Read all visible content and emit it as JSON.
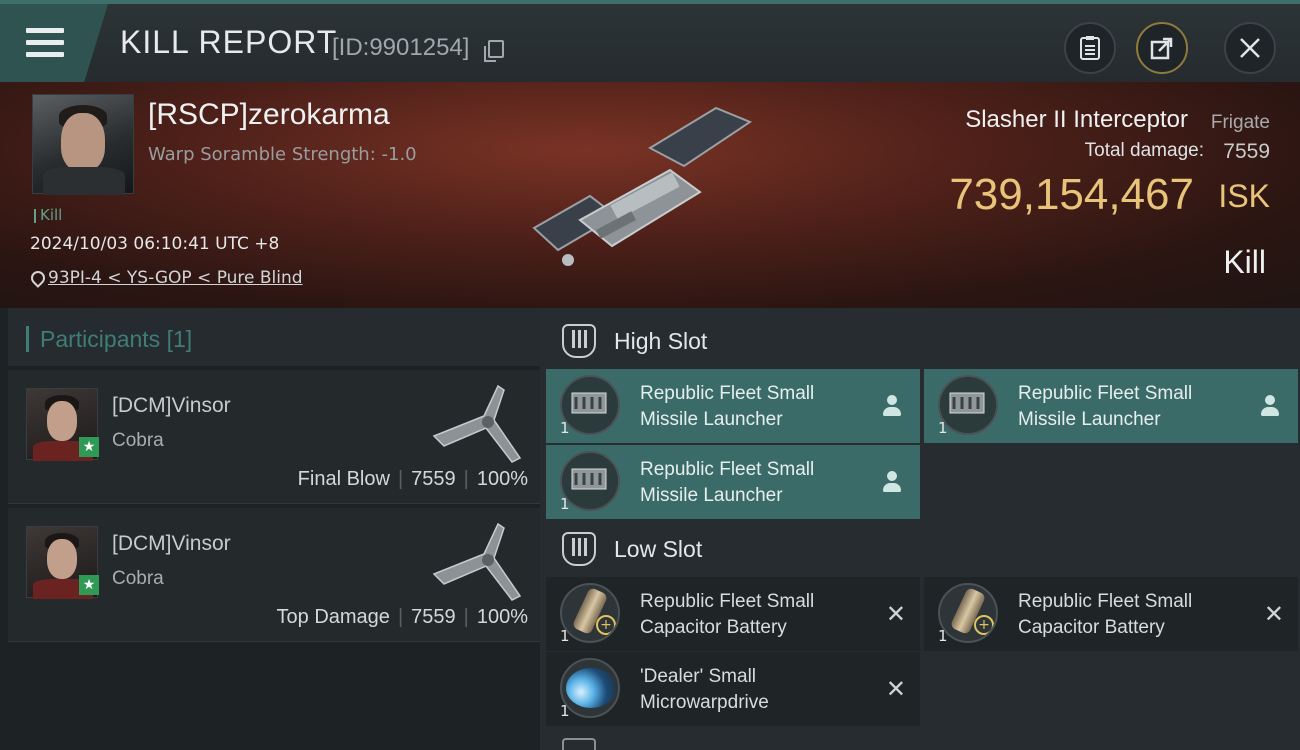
{
  "header": {
    "title": "KILL REPORT",
    "report_id": "[ID:9901254]"
  },
  "victim": {
    "name": "[RSCP]zerokarma",
    "warp_scramble": "Warp Soramble Strength: -1.0",
    "kill_tag": "Kill",
    "datetime": "2024/10/03 06:10:41 UTC +8",
    "location": "93PI-4 < YS-GOP < Pure Blind",
    "ship_name": "Slasher II Interceptor",
    "ship_class": "Frigate",
    "total_damage_label": "Total damage:",
    "total_damage_value": "7559",
    "isk_value": "739,154,467",
    "isk_unit": "ISK",
    "kill_label": "Kill"
  },
  "participants": {
    "title": "Participants",
    "count": "[1]",
    "items": [
      {
        "name": "[DCM]Vinsor",
        "ship": "Cobra",
        "role": "Final Blow",
        "damage": "7559",
        "percent": "100%"
      },
      {
        "name": "[DCM]Vinsor",
        "ship": "Cobra",
        "role": "Top Damage",
        "damage": "7559",
        "percent": "100%"
      }
    ]
  },
  "slots": {
    "high": {
      "title": "High Slot",
      "modules": [
        {
          "name_line1": "Republic Fleet Small",
          "name_line2": "Missile Launcher",
          "qty": "1"
        },
        {
          "name_line1": "Republic Fleet Small",
          "name_line2": "Missile Launcher",
          "qty": "1"
        },
        {
          "name_line1": "Republic Fleet Small",
          "name_line2": "Missile Launcher",
          "qty": "1"
        }
      ]
    },
    "low": {
      "title": "Low Slot",
      "modules": [
        {
          "name_line1": "Republic Fleet Small",
          "name_line2": "Capacitor Battery",
          "qty": "1"
        },
        {
          "name_line1": "Republic Fleet Small",
          "name_line2": "Capacitor Battery",
          "qty": "1"
        },
        {
          "name_line1": "'Dealer' Small",
          "name_line2": "Microwarpdrive",
          "qty": "1"
        }
      ]
    }
  },
  "colors": {
    "accent_teal": "#3f7d78",
    "isk_gold": "#e8c47a",
    "active_module": "#3b6b68"
  },
  "icons": [
    "menu-icon",
    "copy-icon",
    "clipboard-icon",
    "share-icon",
    "close-icon",
    "pin-icon",
    "slot-icon",
    "user-icon",
    "cross-icon",
    "star-icon"
  ]
}
